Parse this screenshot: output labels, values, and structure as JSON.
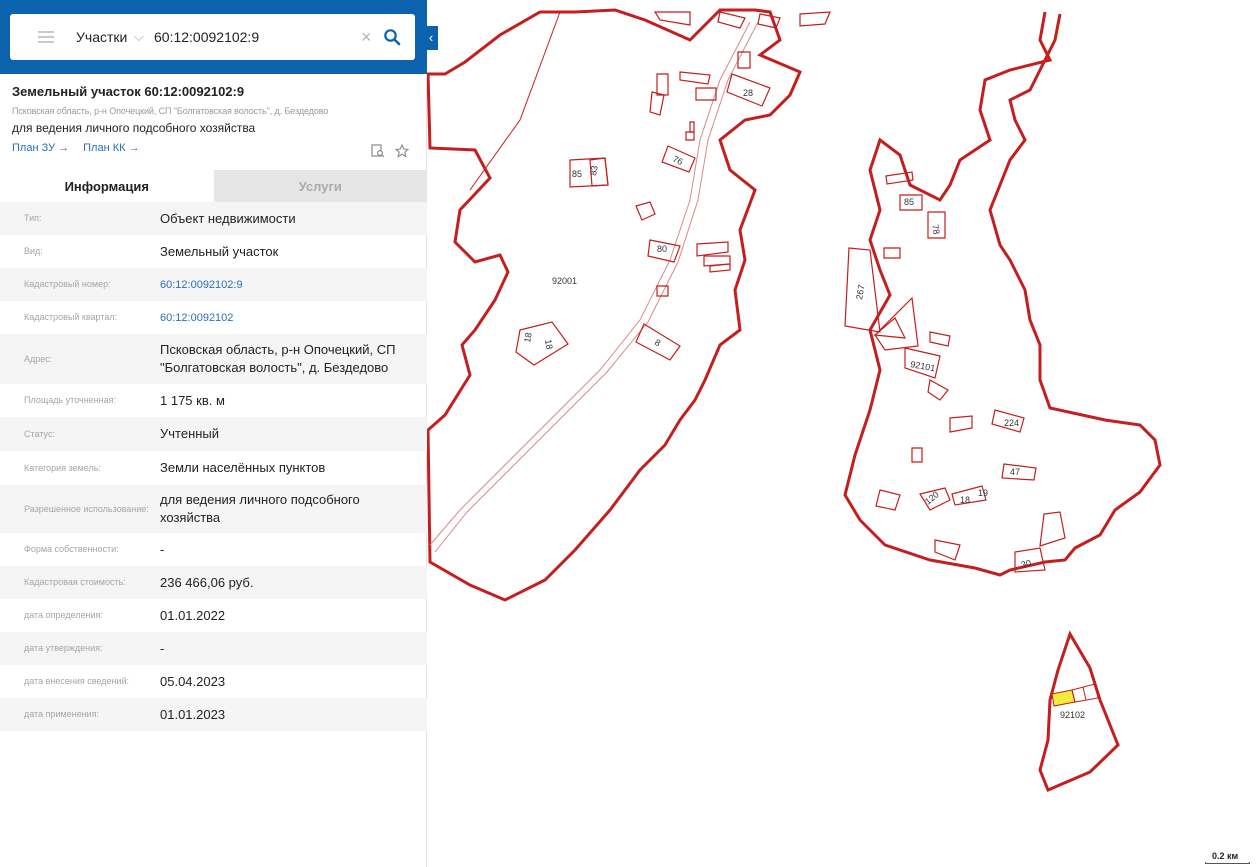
{
  "search": {
    "layer": "Участки",
    "query": "60:12:0092102:9"
  },
  "object": {
    "title": "Земельный участок 60:12:0092102:9",
    "address": "Псковская область, р-н Опочецкий, СП \"Болгатовская волость\", д. Бездедово",
    "use": "для ведения личного подсобного хозяйства",
    "plan_zu": "План ЗУ →",
    "plan_kk": "План КК →"
  },
  "tabs": {
    "info": "Информация",
    "services": "Услуги"
  },
  "info_rows": [
    {
      "key": "Тип:",
      "value": "Объект недвижимости"
    },
    {
      "key": "Вид:",
      "value": "Земельный участок"
    },
    {
      "key": "Кадастровый номер:",
      "value": "60:12:0092102:9"
    },
    {
      "key": "Кадастровый квартал:",
      "value": "60:12:0092102"
    },
    {
      "key": "Адрес:",
      "value": "Псковская область, р-н Опочецкий, СП \"Болгатовская волость\", д. Бездедово"
    },
    {
      "key": "Площадь уточненная:",
      "value": "1 175 кв. м"
    },
    {
      "key": "Статус:",
      "value": "Учтенный"
    },
    {
      "key": "Категория земель:",
      "value": "Земли населённых пунктов"
    },
    {
      "key": "Разрешенное использование:",
      "value": "для ведения личного подсобного хозяйства"
    },
    {
      "key": "Форма собственности:",
      "value": "-"
    },
    {
      "key": "Кадастровая стоимость:",
      "value": "236 466,06 руб."
    },
    {
      "key": "дата определения:",
      "value": "01.01.2022"
    },
    {
      "key": "дата утверждения:",
      "value": "-"
    },
    {
      "key": "дата внесения сведений:",
      "value": "05.04.2023"
    },
    {
      "key": "дата применения:",
      "value": "01.01.2023"
    }
  ],
  "map": {
    "labels": {
      "q92001": "92001",
      "q92102": "92102",
      "q92101": "92101",
      "n28": "28",
      "n76": "76",
      "n85a": "85",
      "n83": "83",
      "n80": "80",
      "n8": "8",
      "n18a": "18",
      "n18b": "18",
      "n85b": "85",
      "n78": "78",
      "n267": "267",
      "n224": "224",
      "n47": "47",
      "n120": "120",
      "n18c": "18",
      "n19": "19",
      "n30": "30"
    },
    "scale": "0.2 км",
    "colors": {
      "boundary": "#c41e1e",
      "selected": "#f4ea3c"
    }
  }
}
